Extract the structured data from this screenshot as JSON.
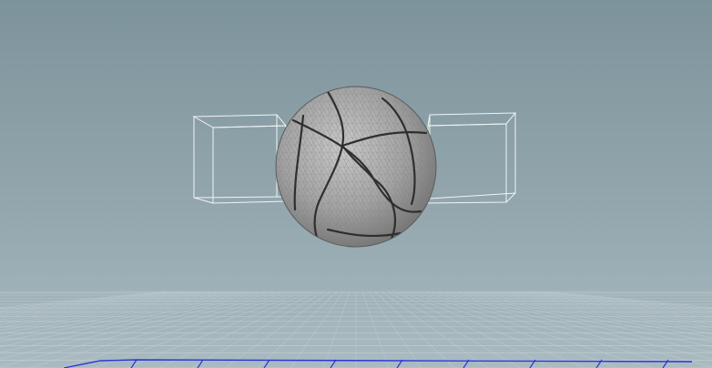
{
  "viewport": {
    "background_top_color": "#7f959d",
    "background_bottom_color": "#a4b6bc",
    "grid_color": "#c9d4d8",
    "grid_axis_color": "#2a35d6",
    "wireframe_color": "#f4f6f7",
    "mesh_color": "#a7a7a7",
    "seam_color": "#2e2e2e"
  },
  "scene": {
    "objects": [
      {
        "name": "sphere-mesh",
        "kind": "tetrahedral-ball"
      },
      {
        "name": "left-box-wireframe",
        "kind": "wireframe-box"
      },
      {
        "name": "right-box-wireframe",
        "kind": "wireframe-box"
      },
      {
        "name": "ground-grid",
        "kind": "reference-grid"
      }
    ]
  }
}
